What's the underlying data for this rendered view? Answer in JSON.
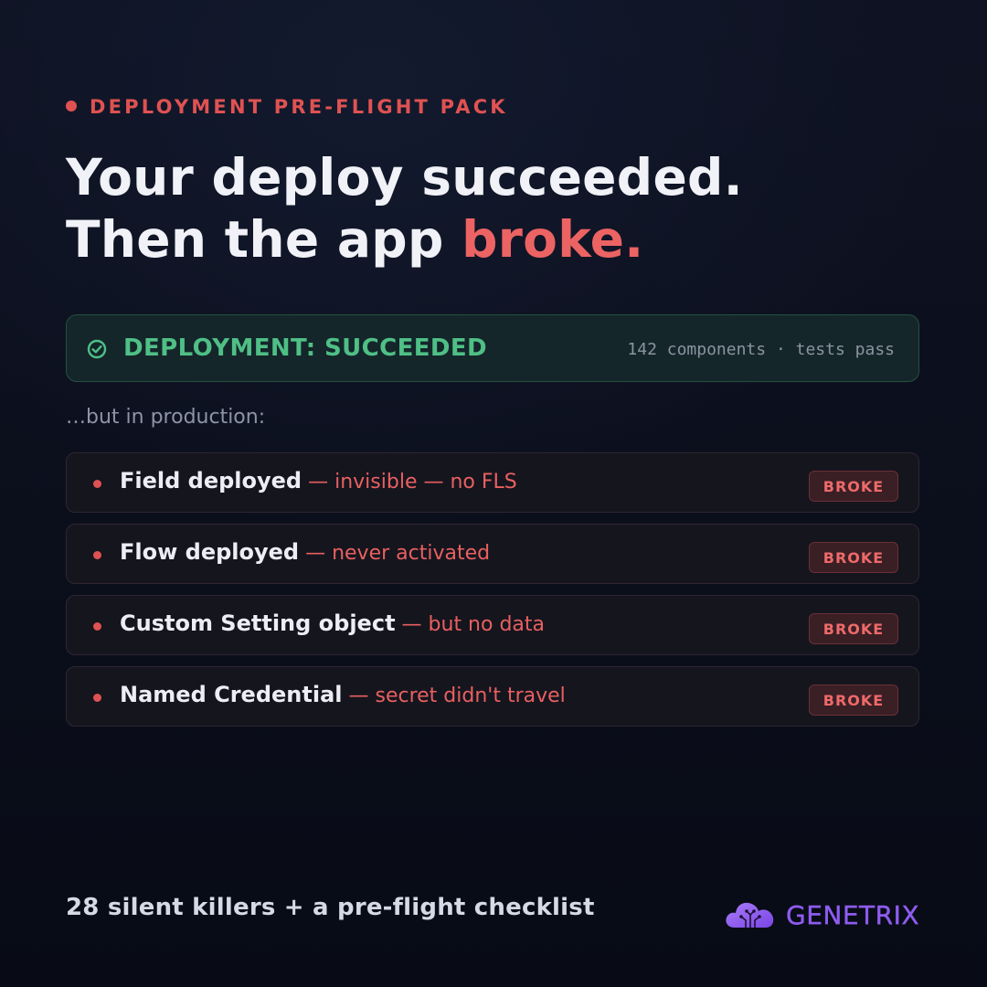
{
  "eyebrow": "DEPLOYMENT PRE-FLIGHT PACK",
  "headline": {
    "line1": "Your deploy succeeded.",
    "line2_prefix": "Then the app ",
    "line2_accent": "broke."
  },
  "status_banner": {
    "icon": "check-circle-icon",
    "title": "DEPLOYMENT: SUCCEEDED",
    "meta": "142 components · tests pass",
    "color": "#4fbf86"
  },
  "subhead": "…but in production:",
  "issues": [
    {
      "name": "Field deployed",
      "detail": " — invisible — no FLS",
      "badge": "BROKE"
    },
    {
      "name": "Flow deployed",
      "detail": " — never activated",
      "badge": "BROKE"
    },
    {
      "name": "Custom Setting object",
      "detail": " — but no data",
      "badge": "BROKE"
    },
    {
      "name": "Named Credential",
      "detail": " — secret didn't travel",
      "badge": "BROKE"
    }
  ],
  "footer": "28 silent killers + a pre-flight checklist",
  "brand": {
    "name": "GENETRIX",
    "icon": "cloud-circuit-icon",
    "color": "#8e5cf0"
  },
  "colors": {
    "accent_red": "#e05252",
    "success_green": "#4fbf86",
    "background": "#0b0f1c"
  }
}
